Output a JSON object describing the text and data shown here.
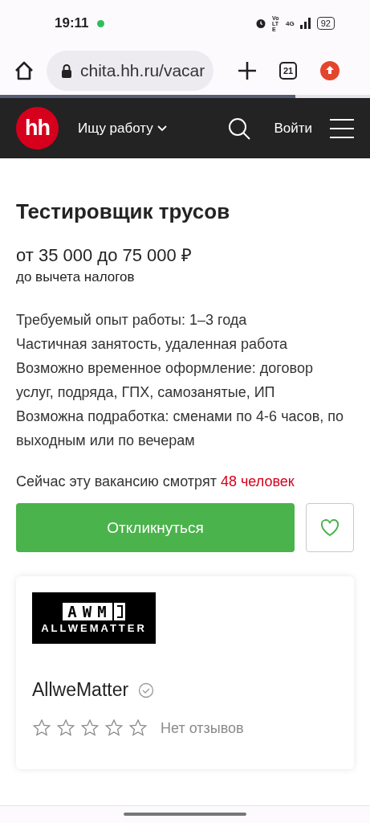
{
  "status_bar": {
    "time": "19:11",
    "network": "Vo LTE",
    "signal": "4G",
    "battery": "92"
  },
  "browser": {
    "url": "chita.hh.ru/vacar",
    "tabs_count": "21"
  },
  "header": {
    "logo": "hh",
    "menu": "Ищу работу",
    "login": "Войти"
  },
  "vacancy": {
    "title": "Тестировщик трусов",
    "salary": "от 35 000 до 75 000 ₽",
    "salary_note": "до вычета налогов",
    "details": [
      "Требуемый опыт работы: 1–3 года",
      "Частичная занятость, удаленная работа",
      "Возможно временное оформление: договор услуг, подряда, ГПХ, самозанятые, ИП",
      "Возможна подработка: сменами по 4-6 часов, по выходным или по вечерам"
    ],
    "viewers_text": "Сейчас эту вакансию смотрят",
    "viewers_count": "48 человек",
    "apply_button": "Откликнуться",
    "favorite": false
  },
  "company": {
    "logo_top": "AWM",
    "logo_bottom": "ALLWEMATTER",
    "name": "AllweMatter",
    "verified": true,
    "stars": 0,
    "reviews": "Нет отзывов"
  }
}
